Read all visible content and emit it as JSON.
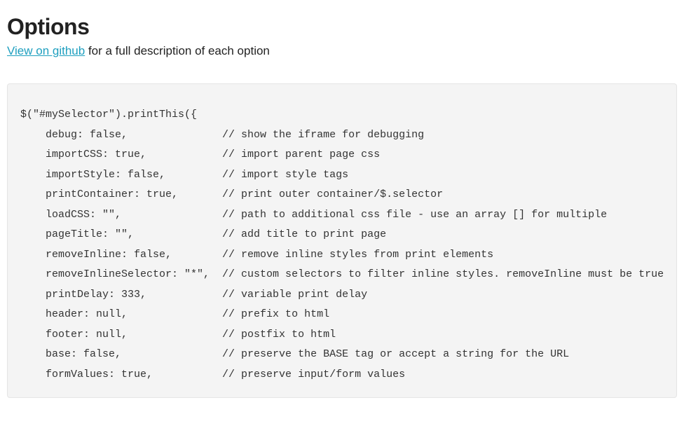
{
  "heading": "Options",
  "link_text": "View on github",
  "subtitle_tail": " for a full description of each option",
  "code": "$(\"#mySelector\").printThis({\n    debug: false,               // show the iframe for debugging\n    importCSS: true,            // import parent page css\n    importStyle: false,         // import style tags\n    printContainer: true,       // print outer container/$.selector\n    loadCSS: \"\",                // path to additional css file - use an array [] for multiple\n    pageTitle: \"\",              // add title to print page\n    removeInline: false,        // remove inline styles from print elements\n    removeInlineSelector: \"*\",  // custom selectors to filter inline styles. removeInline must be true\n    printDelay: 333,            // variable print delay\n    header: null,               // prefix to html\n    footer: null,               // postfix to html\n    base: false,                // preserve the BASE tag or accept a string for the URL\n    formValues: true,           // preserve input/form values"
}
